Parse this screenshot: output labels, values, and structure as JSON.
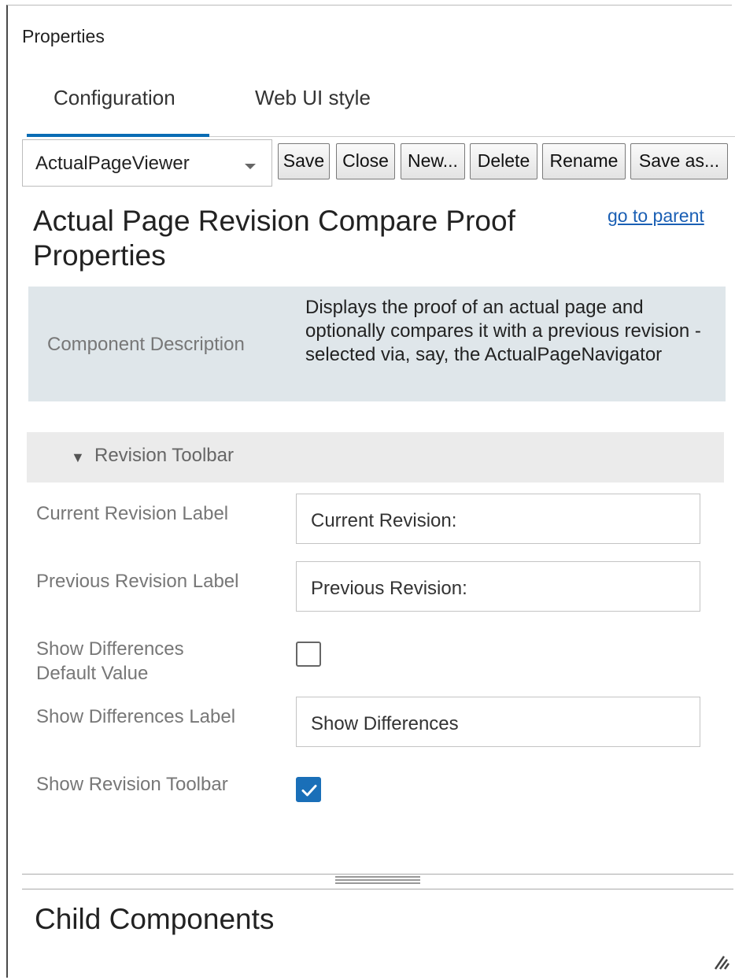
{
  "panel": {
    "title": "Properties"
  },
  "tabs": [
    {
      "label": "Configuration",
      "active": true
    },
    {
      "label": "Web UI style",
      "active": false
    }
  ],
  "toolbar": {
    "selected_view": "ActualPageViewer",
    "save_label": "Save",
    "close_label": "Close",
    "new_label": "New...",
    "delete_label": "Delete",
    "rename_label": "Rename",
    "save_as_label": "Save as..."
  },
  "heading": {
    "title": "Actual Page Revision Compare Proof Properties",
    "go_to_parent": "go to parent"
  },
  "description": {
    "label": "Component Description",
    "text": "Displays the proof of an actual page and optionally compares it with a previous revision - selected via, say, the ActualPageNavigator"
  },
  "section": {
    "title": "Revision Toolbar",
    "expanded": true,
    "properties": [
      {
        "label": "Current Revision Label",
        "type": "text",
        "value": "Current Revision:"
      },
      {
        "label": "Previous Revision Label",
        "type": "text",
        "value": "Previous Revision:"
      },
      {
        "label": "Show Differences Default Value",
        "type": "checkbox",
        "checked": false
      },
      {
        "label": "Show Differences Label",
        "type": "text",
        "value": "Show Differences"
      },
      {
        "label": "Show Revision Toolbar",
        "type": "checkbox",
        "checked": true
      }
    ]
  },
  "child_components": {
    "title": "Child Components"
  },
  "colors": {
    "accent": "#0a6cb4",
    "checkbox_on": "#1a6fb8",
    "link": "#1a5fb4",
    "description_bg": "#dfe6ea"
  }
}
